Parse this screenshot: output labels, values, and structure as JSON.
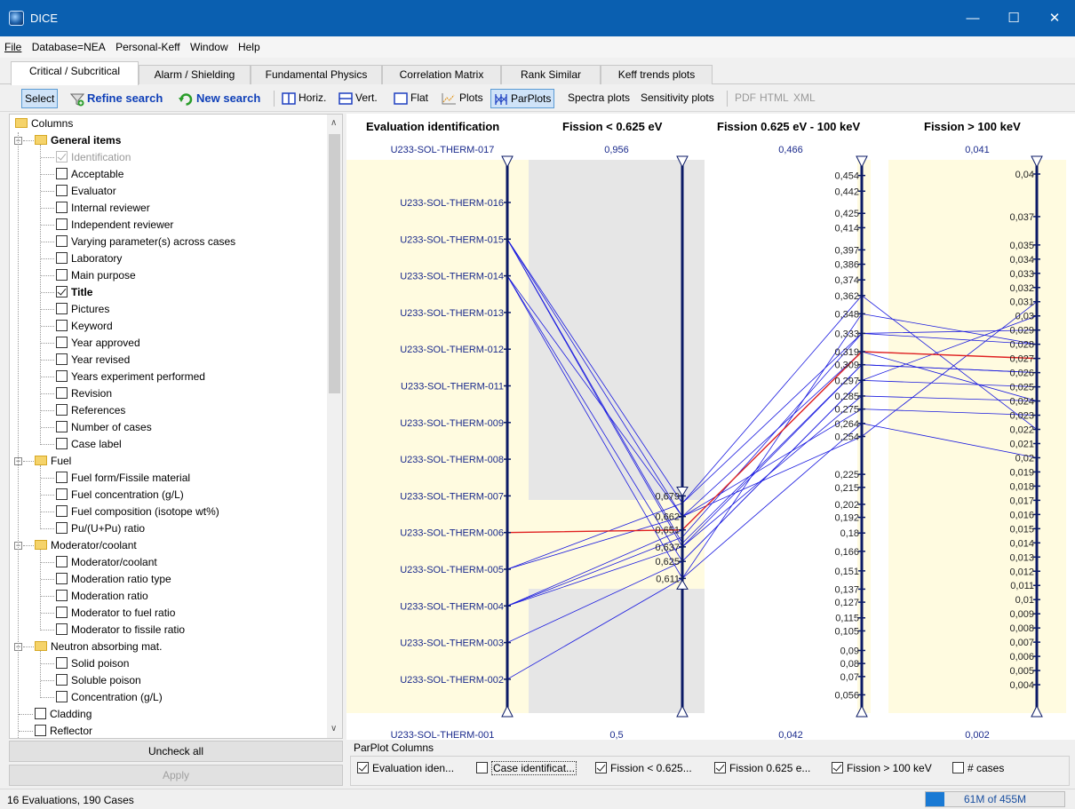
{
  "window": {
    "title": "DICE",
    "minimize": "—",
    "maximize": "☐",
    "close": "✕"
  },
  "menu": [
    "File",
    "Database=NEA",
    "Personal-Keff",
    "Window",
    "Help"
  ],
  "tabs": [
    "Critical / Subcritical",
    "Alarm / Shielding",
    "Fundamental Physics",
    "Correlation Matrix",
    "Rank Similar",
    "Keff trends plots"
  ],
  "toolbar": {
    "select": "Select",
    "refine": "Refine search",
    "new_search": "New search",
    "horiz": "Horiz.",
    "vert": "Vert.",
    "flat": "Flat",
    "plots": "Plots",
    "parplots": "ParPlots",
    "spectra": "Spectra plots",
    "sensitivity": "Sensitivity plots",
    "pdf": "PDF",
    "html": "HTML",
    "xml": "XML"
  },
  "tree": [
    {
      "label": "Columns",
      "kind": "root"
    },
    {
      "label": "General items",
      "kind": "group",
      "bold": true
    },
    {
      "label": "Identification",
      "kind": "item",
      "checked": true,
      "disabled": true
    },
    {
      "label": "Acceptable",
      "kind": "item",
      "checked": false
    },
    {
      "label": "Evaluator",
      "kind": "item",
      "checked": false
    },
    {
      "label": "Internal reviewer",
      "kind": "item",
      "checked": false
    },
    {
      "label": "Independent reviewer",
      "kind": "item",
      "checked": false
    },
    {
      "label": "Varying parameter(s) across cases",
      "kind": "item",
      "checked": false
    },
    {
      "label": "Laboratory",
      "kind": "item",
      "checked": false
    },
    {
      "label": "Main purpose",
      "kind": "item",
      "checked": false
    },
    {
      "label": "Title",
      "kind": "item",
      "checked": true,
      "bold": true
    },
    {
      "label": "Pictures",
      "kind": "item",
      "checked": false
    },
    {
      "label": "Keyword",
      "kind": "item",
      "checked": false
    },
    {
      "label": "Year approved",
      "kind": "item",
      "checked": false
    },
    {
      "label": "Year revised",
      "kind": "item",
      "checked": false
    },
    {
      "label": "Years experiment performed",
      "kind": "item",
      "checked": false
    },
    {
      "label": "Revision",
      "kind": "item",
      "checked": false
    },
    {
      "label": "References",
      "kind": "item",
      "checked": false
    },
    {
      "label": "Number of cases",
      "kind": "item",
      "checked": false
    },
    {
      "label": "Case label",
      "kind": "item",
      "checked": false
    },
    {
      "label": "Fuel",
      "kind": "group"
    },
    {
      "label": "Fuel form/Fissile material",
      "kind": "item",
      "checked": false
    },
    {
      "label": "Fuel concentration (g/L)",
      "kind": "item",
      "checked": false
    },
    {
      "label": "Fuel composition (isotope wt%)",
      "kind": "item",
      "checked": false
    },
    {
      "label": "Pu/(U+Pu) ratio",
      "kind": "item",
      "checked": false
    },
    {
      "label": "Moderator/coolant",
      "kind": "group"
    },
    {
      "label": "Moderator/coolant",
      "kind": "item",
      "checked": false
    },
    {
      "label": "Moderation ratio type",
      "kind": "item",
      "checked": false
    },
    {
      "label": "Moderation ratio",
      "kind": "item",
      "checked": false
    },
    {
      "label": "Moderator to fuel ratio",
      "kind": "item",
      "checked": false
    },
    {
      "label": "Moderator to fissile ratio",
      "kind": "item",
      "checked": false
    },
    {
      "label": "Neutron absorbing mat.",
      "kind": "group"
    },
    {
      "label": "Solid poison",
      "kind": "item",
      "checked": false
    },
    {
      "label": "Soluble poison",
      "kind": "item",
      "checked": false
    },
    {
      "label": "Concentration (g/L)",
      "kind": "item",
      "checked": false
    },
    {
      "label": "Cladding",
      "kind": "top",
      "checked": false
    },
    {
      "label": "Reflector",
      "kind": "top",
      "checked": false
    }
  ],
  "buttons": {
    "uncheck_all": "Uncheck all",
    "apply": "Apply"
  },
  "parplot": {
    "headers": [
      "Evaluation identification",
      "Fission < 0.625 eV",
      "Fission 0.625 eV - 100 keV",
      "Fission > 100 keV"
    ],
    "top_values": [
      "U233-SOL-THERM-017",
      "0,956",
      "0,466",
      "0,041"
    ],
    "bottom_values": [
      "U233-SOL-THERM-001",
      "0,5",
      "0,042",
      "0,002"
    ],
    "eval_ticks": [
      "U233-SOL-THERM-016",
      "U233-SOL-THERM-015",
      "U233-SOL-THERM-014",
      "U233-SOL-THERM-013",
      "U233-SOL-THERM-012",
      "U233-SOL-THERM-011",
      "U233-SOL-THERM-009",
      "U233-SOL-THERM-008",
      "U233-SOL-THERM-007",
      "U233-SOL-THERM-006",
      "U233-SOL-THERM-005",
      "U233-SOL-THERM-004",
      "U233-SOL-THERM-003",
      "U233-SOL-THERM-002"
    ],
    "axis2_ticks": [
      "0,679",
      "0,662",
      "0,651",
      "0,637",
      "0,625",
      "0,611"
    ],
    "axis3_ticks": [
      "0,454",
      "0,442",
      "0,425",
      "0,414",
      "0,397",
      "0,386",
      "0,374",
      "0,362",
      "0,348",
      "0,333",
      "0,319",
      "0,309",
      "0,297",
      "0,285",
      "0,275",
      "0,264",
      "0,254",
      "0,225",
      "0,215",
      "0,202",
      "0,192",
      "0,18",
      "0,166",
      "0,151",
      "0,137",
      "0,127",
      "0,115",
      "0,105",
      "0,09",
      "0,08",
      "0,07",
      "0,056"
    ],
    "axis4_ticks": [
      "0,04",
      "0,037",
      "0,035",
      "0,034",
      "0,033",
      "0,032",
      "0,031",
      "0,03",
      "0,029",
      "0,028",
      "0,027",
      "0,026",
      "0,025",
      "0,024",
      "0,023",
      "0,022",
      "0,021",
      "0,02",
      "0,019",
      "0,018",
      "0,017",
      "0,016",
      "0,015",
      "0,014",
      "0,013",
      "0,012",
      "0,011",
      "0,01",
      "0,009",
      "0,008",
      "0,007",
      "0,006",
      "0,005",
      "0,004"
    ],
    "colors": {
      "line": "#1a1adf",
      "highlight": "#e02020",
      "axis": "#0b1a66",
      "band": "#fffbe0",
      "gray": "#e6e6e6"
    }
  },
  "parplot_columns": {
    "title": "ParPlot Columns",
    "items": [
      {
        "label": "Evaluation iden...",
        "checked": true
      },
      {
        "label": "Case identificat...",
        "checked": false
      },
      {
        "label": "Fission < 0.625...",
        "checked": true
      },
      {
        "label": "Fission 0.625 e...",
        "checked": true
      },
      {
        "label": "Fission > 100 keV",
        "checked": true
      },
      {
        "label": "# cases",
        "checked": false
      }
    ]
  },
  "status": {
    "text": "16 Evaluations, 190 Cases",
    "memory": "61M of 455M",
    "memory_fraction": 0.134
  }
}
